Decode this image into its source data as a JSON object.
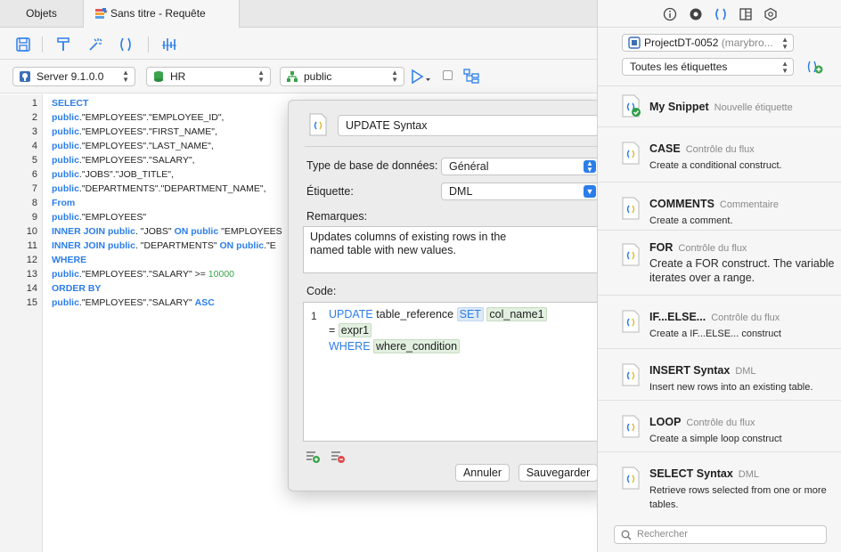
{
  "tabs": {
    "objects": "Objets",
    "query": "* Sans titre - Requête"
  },
  "toolbar": {
    "icons": [
      "save-icon",
      "format-icon",
      "magic-wand-icon",
      "code-snippet-icon",
      "explain-icon"
    ]
  },
  "selectors": {
    "server": "Server 9.1.0.0",
    "database": "HR",
    "schema": "public"
  },
  "editor": {
    "line_numbers": [
      "1",
      "2",
      "3",
      "4",
      "5",
      "6",
      "7",
      "8",
      "9",
      "10",
      "11",
      "12",
      "13",
      "14",
      "15"
    ]
  },
  "dialog": {
    "title_value": "UPDATE Syntax",
    "db_type_label": "Type de base de données:",
    "db_type_value": "Général",
    "tag_label": "Étiquette:",
    "tag_value": "DML",
    "remarks_label": "Remarques:",
    "remarks_line1": "Updates columns of existing rows in the",
    "remarks_line2": "named table with new values.",
    "code_label": "Code:",
    "code_line_number": "1",
    "code": {
      "update_kw": "UPDATE",
      "table_ref": "table_reference",
      "set_kw": "SET",
      "col_name": "col_name1",
      "eq": "=",
      "expr": "expr1",
      "where_kw": "WHERE",
      "where_cond": "where_condition"
    },
    "cancel_label": "Annuler",
    "save_label": "Sauvegarder"
  },
  "right_panel": {
    "project_name": "ProjectDT-0052",
    "project_owner": "(marybro...",
    "tags_filter": "Toutes les étiquettes",
    "search_placeholder": "Rechercher",
    "snippets": [
      {
        "name": "My Snippet",
        "tag": "Nouvelle étiquette",
        "desc": ""
      },
      {
        "name": "CASE",
        "tag": "Contrôle du flux",
        "desc": "Create a conditional construct."
      },
      {
        "name": "COMMENTS",
        "tag": "Commentaire",
        "desc": "Create a comment."
      },
      {
        "name": "FOR",
        "tag": "Contrôle du flux",
        "desc": "Create a FOR construct. The variable iterates over a range."
      },
      {
        "name": "IF...ELSE...",
        "tag": "Contrôle du flux",
        "desc": "Create a IF...ELSE... construct"
      },
      {
        "name": "INSERT Syntax",
        "tag": "DML",
        "desc": "Insert new rows into an existing table."
      },
      {
        "name": "LOOP",
        "tag": "Contrôle du flux",
        "desc": "Create a simple loop construct"
      },
      {
        "name": "SELECT Syntax",
        "tag": "DML",
        "desc": "Retrieve rows selected from one or more tables."
      }
    ]
  },
  "colors": {
    "accent": "#2b7de9",
    "keyword": "#2b7de9",
    "number": "#3aa34c"
  }
}
